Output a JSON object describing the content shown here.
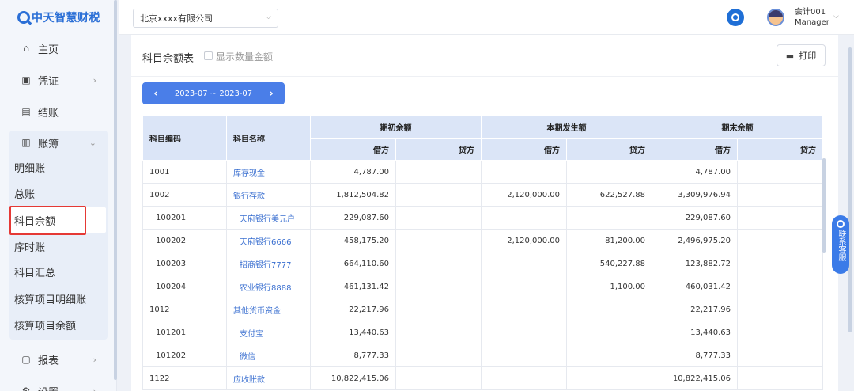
{
  "logo": {
    "text": "中天智慧财税"
  },
  "sidebar": {
    "items": [
      {
        "label": "主页",
        "icon": "home-icon",
        "glyph": "⌂"
      },
      {
        "label": "凭证",
        "icon": "voucher-icon",
        "glyph": "▣"
      },
      {
        "label": "结账",
        "icon": "checkout-icon",
        "glyph": "▤"
      },
      {
        "label": "账簿",
        "icon": "ledger-icon",
        "glyph": "▥"
      },
      {
        "label": "报表",
        "icon": "report-icon",
        "glyph": "▢"
      },
      {
        "label": "设置",
        "icon": "settings-icon",
        "glyph": "⚙"
      }
    ],
    "ledger_sub": [
      "明细账",
      "总账",
      "科目余额",
      "序时账",
      "科目汇总",
      "核算项目明细账",
      "核算项目余额"
    ],
    "active": "科目余额"
  },
  "topbar": {
    "company": "北京xxxx有限公司",
    "user_name": "会计001",
    "user_role": "Manager"
  },
  "page": {
    "title": "科目余额表",
    "show_qty_label": "显示数量金额",
    "print_label": "打印",
    "period_range": "2023-07 ~ 2023-07",
    "prev_arrow": "‹",
    "next_arrow": "›"
  },
  "table": {
    "h_code": "科目编码",
    "h_name": "科目名称",
    "h_open": "期初余额",
    "h_period": "本期发生额",
    "h_close": "期末余额",
    "h_debit": "借方",
    "h_credit": "贷方",
    "rows": [
      {
        "code": "1001",
        "name": "库存现金",
        "od": "4,787.00",
        "oc": "",
        "pd": "",
        "pc": "",
        "cd": "4,787.00",
        "cc": ""
      },
      {
        "code": "1002",
        "name": "银行存款",
        "od": "1,812,504.82",
        "oc": "",
        "pd": "2,120,000.00",
        "pc": "622,527.88",
        "cd": "3,309,976.94",
        "cc": ""
      },
      {
        "code": "100201",
        "name": "天府银行美元户",
        "od": "229,087.60",
        "oc": "",
        "pd": "",
        "pc": "",
        "cd": "229,087.60",
        "cc": ""
      },
      {
        "code": "100202",
        "name": "天府银行6666",
        "od": "458,175.20",
        "oc": "",
        "pd": "2,120,000.00",
        "pc": "81,200.00",
        "cd": "2,496,975.20",
        "cc": ""
      },
      {
        "code": "100203",
        "name": "招商银行7777",
        "od": "664,110.60",
        "oc": "",
        "pd": "",
        "pc": "540,227.88",
        "cd": "123,882.72",
        "cc": ""
      },
      {
        "code": "100204",
        "name": "农业银行8888",
        "od": "461,131.42",
        "oc": "",
        "pd": "",
        "pc": "1,100.00",
        "cd": "460,031.42",
        "cc": ""
      },
      {
        "code": "1012",
        "name": "其他货币资金",
        "od": "22,217.96",
        "oc": "",
        "pd": "",
        "pc": "",
        "cd": "22,217.96",
        "cc": ""
      },
      {
        "code": "101201",
        "name": "支付宝",
        "od": "13,440.63",
        "oc": "",
        "pd": "",
        "pc": "",
        "cd": "13,440.63",
        "cc": ""
      },
      {
        "code": "101202",
        "name": "微信",
        "od": "8,777.33",
        "oc": "",
        "pd": "",
        "pc": "",
        "cd": "8,777.33",
        "cc": ""
      },
      {
        "code": "1122",
        "name": "应收账款",
        "od": "10,822,415.06",
        "oc": "",
        "pd": "",
        "pc": "",
        "cd": "10,822,415.06",
        "cc": ""
      }
    ]
  },
  "contact": {
    "label": "联系客服"
  },
  "colors": {
    "accent": "#4a7ee8",
    "header_bg": "#dbe5f7",
    "link": "#3a6fd0",
    "highlight": "#e53935"
  }
}
